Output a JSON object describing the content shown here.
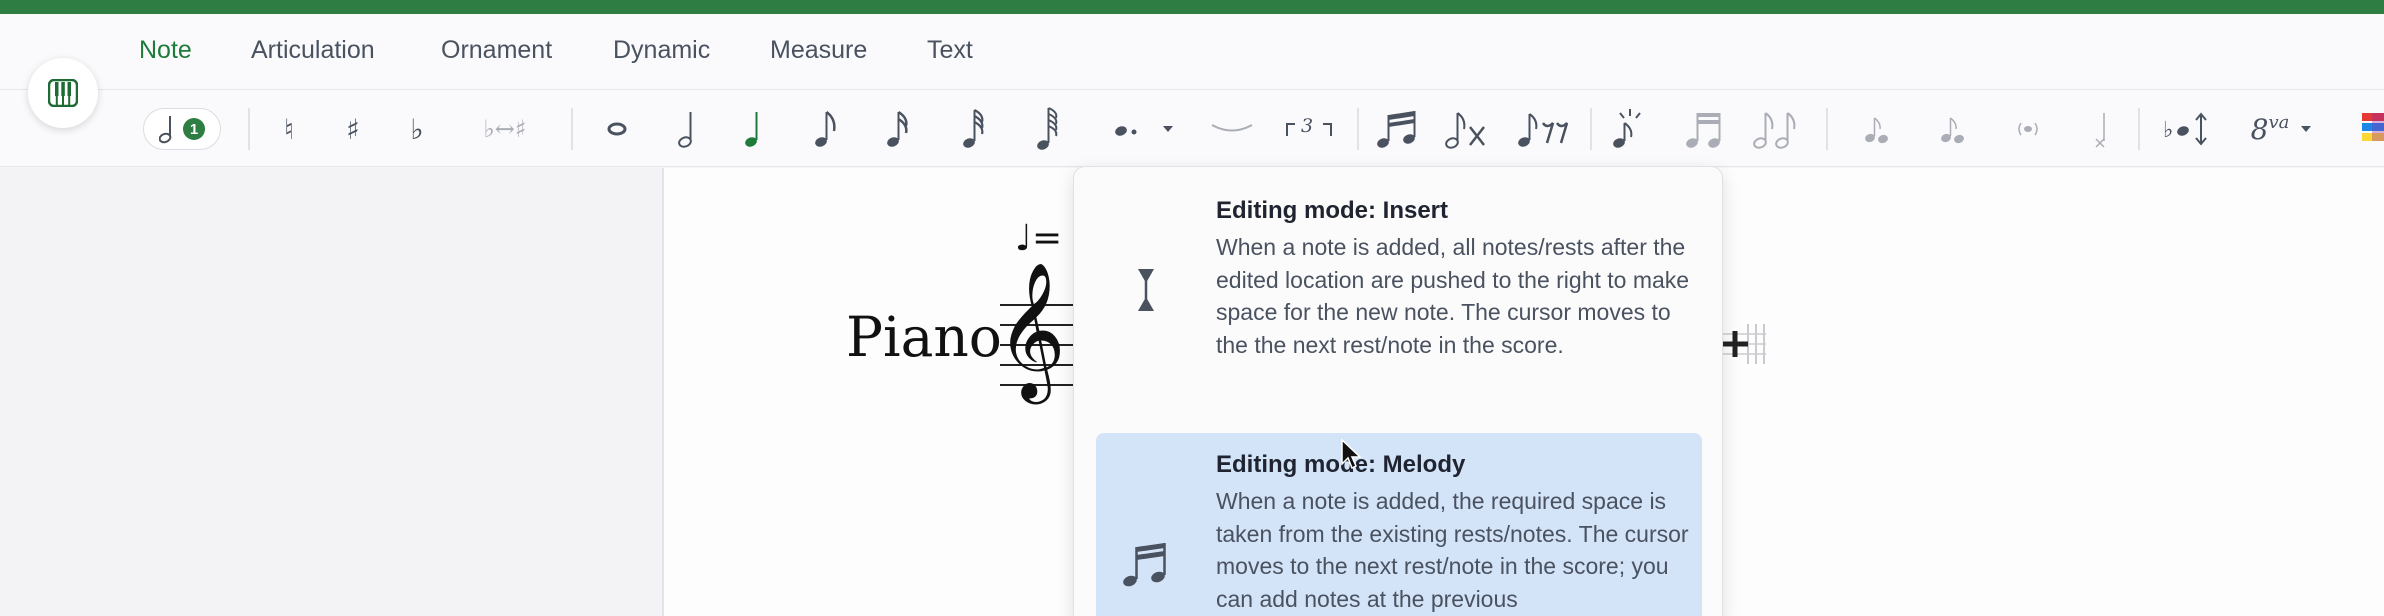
{
  "tabs": [
    {
      "label": "Note",
      "active": true
    },
    {
      "label": "Articulation",
      "active": false
    },
    {
      "label": "Ornament",
      "active": false
    },
    {
      "label": "Dynamic",
      "active": false
    },
    {
      "label": "Measure",
      "active": false
    },
    {
      "label": "Text",
      "active": false
    }
  ],
  "toolbar": {
    "voice_badge": "1",
    "natural": "♮",
    "sharp": "♯",
    "flat": "♭",
    "enharmonic": "♭↔♯",
    "ottava": "8",
    "ottava_suffix": "va",
    "tuplet_number": "3"
  },
  "score": {
    "instrument_label": "Piano",
    "tempo_mark": "♩=",
    "clef": "𝄞"
  },
  "menu": {
    "items": [
      {
        "title": "Editing mode: Insert",
        "description": "When a note is added, all notes/rests after the edited location are pushed to the right to make space for the new note. The cursor moves to the the next rest/note in the score.",
        "selected": false,
        "icon": "insert-cursor-icon"
      },
      {
        "title": "Editing mode: Melody",
        "description": "When a note is added, the required space is taken from the existing rests/notes. The cursor moves to the next rest/note in the score; you can add notes at the previous",
        "selected": true,
        "icon": "beamed-notes-icon"
      }
    ]
  },
  "colors": {
    "accent_green": "#2e7d43",
    "active_tab_text": "#1e7b3a",
    "selected_menu_bg": "#d3e3f8"
  }
}
